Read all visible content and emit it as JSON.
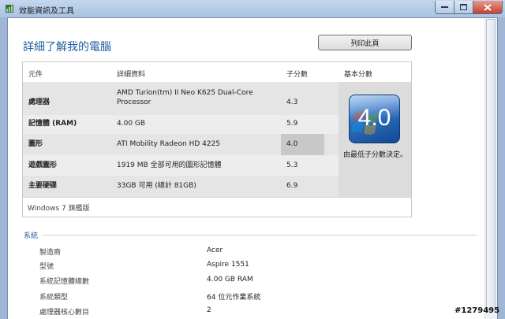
{
  "window": {
    "title": "效能資訊及工具"
  },
  "header": {
    "heading": "詳細了解我的電腦",
    "print_label": "列印此頁"
  },
  "table": {
    "columns": [
      "元件",
      "詳細資料",
      "子分數",
      "基本分數"
    ],
    "rows": [
      {
        "component": "處理器",
        "details": "AMD Turion(tm) II Neo K625 Dual-Core Processor",
        "subscore": "4.3"
      },
      {
        "component": "記憶體 (RAM)",
        "details": "4.00 GB",
        "subscore": "5.9"
      },
      {
        "component": "圖形",
        "details": "ATI Mobility Radeon HD 4225",
        "subscore": "4.0"
      },
      {
        "component": "遊戲圖形",
        "details": "1919 MB 全部可用的圖形記憶體",
        "subscore": "5.3"
      },
      {
        "component": "主要硬碟",
        "details": "33GB 可用 (總計 81GB)",
        "subscore": "6.9"
      }
    ],
    "base_score": "4.0",
    "base_score_note": "由最低子分數決定。",
    "edition": "Windows 7 旗艦版"
  },
  "system": {
    "title": "系統",
    "items": [
      {
        "label": "製造商",
        "value": "Acer"
      },
      {
        "label": "型號",
        "value": "Aspire 1551"
      },
      {
        "label": "系統記憶體總數",
        "value": "4.00 GB RAM"
      },
      {
        "label": "系統類型",
        "value": "64 位元作業系統"
      },
      {
        "label": "處理器核心數目",
        "value": "2"
      }
    ]
  },
  "watermark": "#1279495",
  "colors": {
    "heading_blue": "#1f5ea8",
    "row_gray": "#e5e5e5",
    "highlight_gray": "#c8c8c8",
    "badge_blue": "#2f6fc0"
  }
}
